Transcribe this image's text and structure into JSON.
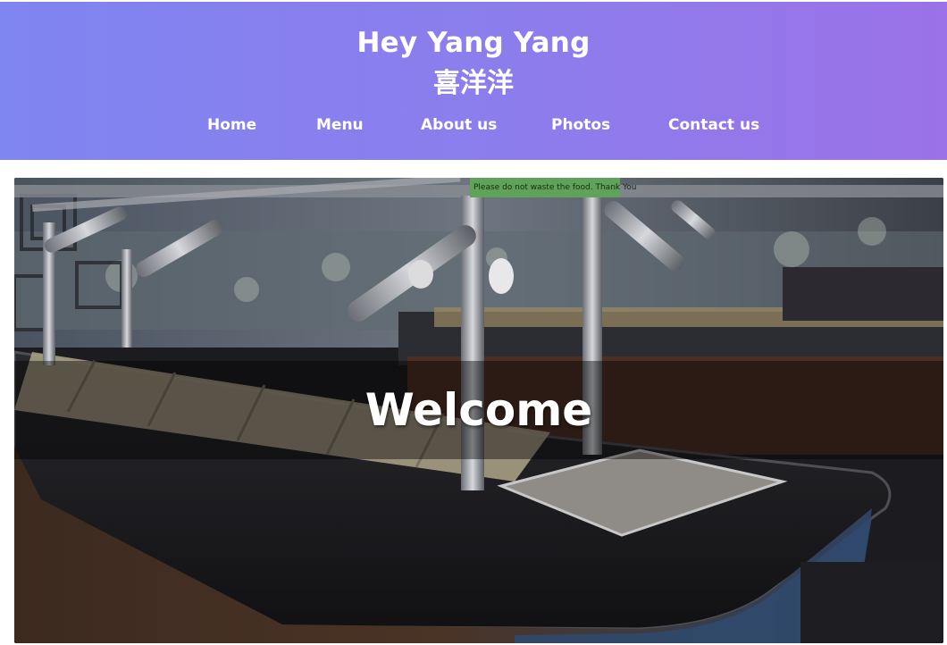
{
  "header": {
    "title": "Hey Yang Yang",
    "subtitle": "喜洋洋"
  },
  "nav": {
    "items": [
      {
        "label": "Home"
      },
      {
        "label": "Menu"
      },
      {
        "label": "About us"
      },
      {
        "label": "Photos"
      },
      {
        "label": "Contact us"
      }
    ]
  },
  "hero": {
    "heading": "Welcome",
    "sign_text": "Please do not waste the food. Thank You"
  },
  "colors": {
    "header_gradient_start": "#7f85f1",
    "header_gradient_end": "#9b72e8",
    "nav_text": "#ffffff",
    "welcome_overlay": "rgba(0,0,0,0.42)"
  }
}
